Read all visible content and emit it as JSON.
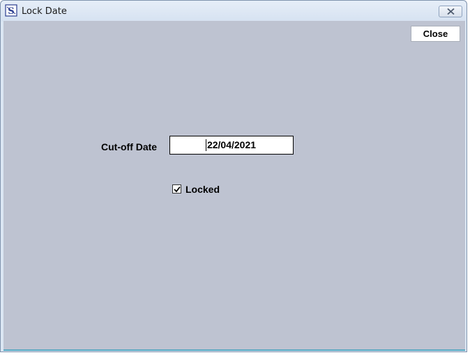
{
  "window": {
    "title": "Lock Date",
    "icon": "app-logo-icon",
    "titlebar_close_icon": "close-icon"
  },
  "toolbar": {
    "close_label": "Close"
  },
  "form": {
    "cutoff_label": "Cut-off Date",
    "cutoff_value": "22/04/2021",
    "locked_label": "Locked",
    "locked_checked": true
  },
  "colors": {
    "client_background": "#bec3d1",
    "titlebar": "#dbe6f3"
  }
}
